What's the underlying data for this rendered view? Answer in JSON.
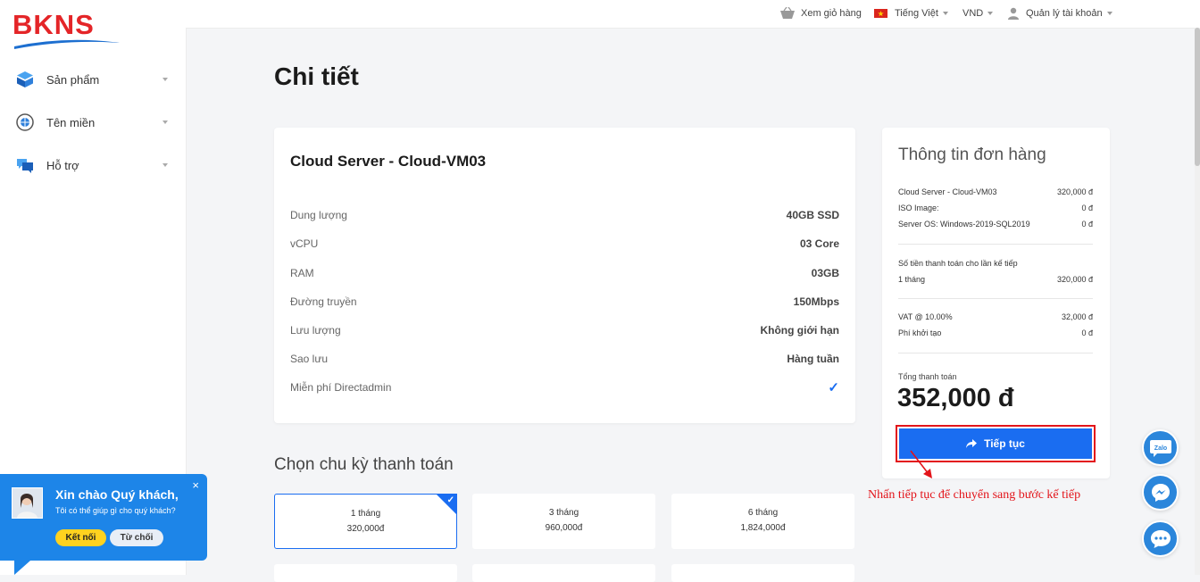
{
  "brand": {
    "logo_text": "BKNS"
  },
  "sidebar": {
    "items": [
      {
        "label": "Sản phẩm"
      },
      {
        "label": "Tên miền"
      },
      {
        "label": "Hỗ trợ"
      }
    ]
  },
  "topbar": {
    "cart": "Xem giỏ hàng",
    "language": "Tiếng Việt",
    "currency": "VND",
    "account": "Quản lý tài khoản"
  },
  "page_title": "Chi tiết",
  "product": {
    "name": "Cloud Server - Cloud-VM03",
    "specs": [
      {
        "key": "Dung lượng",
        "value": "40GB SSD"
      },
      {
        "key": "vCPU",
        "value": "03 Core"
      },
      {
        "key": "RAM",
        "value": "03GB"
      },
      {
        "key": "Đường truyền",
        "value": "150Mbps"
      },
      {
        "key": "Lưu lượng",
        "value": "Không giới hạn"
      },
      {
        "key": "Sao lưu",
        "value": "Hàng tuần"
      },
      {
        "key": "Miễn phí Directadmin",
        "value": "✓"
      }
    ]
  },
  "order": {
    "title": "Thông tin đơn hàng",
    "lines": [
      {
        "label": "Cloud Server - Cloud-VM03",
        "amount": "320,000 đ"
      },
      {
        "label": "ISO Image:",
        "amount": "0 đ"
      },
      {
        "label": "Server OS: Windows-2019-SQL2019",
        "amount": "0 đ"
      }
    ],
    "next_payment_label": "Số tiền thanh toán cho lần kế tiếp",
    "next_payment": {
      "label": "1 tháng",
      "amount": "320,000 đ"
    },
    "vat": {
      "label": "VAT @ 10.00%",
      "amount": "32,000 đ"
    },
    "setup_fee": {
      "label": "Phí khởi tạo",
      "amount": "0 đ"
    },
    "total_label": "Tổng thanh toán",
    "total": "352,000 đ",
    "continue_label": "Tiếp tục"
  },
  "annotation": "Nhấn tiếp tục để chuyển sang bước kế tiếp",
  "billing": {
    "title": "Chọn chu kỳ thanh toán",
    "options": [
      {
        "label": "1 tháng",
        "price": "320,000đ",
        "selected": true
      },
      {
        "label": "3 tháng",
        "price": "960,000đ",
        "selected": false
      },
      {
        "label": "6 tháng",
        "price": "1,824,000đ",
        "selected": false
      }
    ]
  },
  "chat": {
    "greeting": "Xin chào Quý khách,",
    "question": "Tôi có thể giúp gì cho quý khách?",
    "connect": "Kết nối",
    "decline": "Từ chối",
    "close": "×"
  },
  "floating": {
    "zalo": "Zalo"
  },
  "colors": {
    "accent": "#1a6df1",
    "brand_red": "#e42528",
    "chat_blue": "#1d85e8",
    "annotation_red": "#e3141a"
  }
}
